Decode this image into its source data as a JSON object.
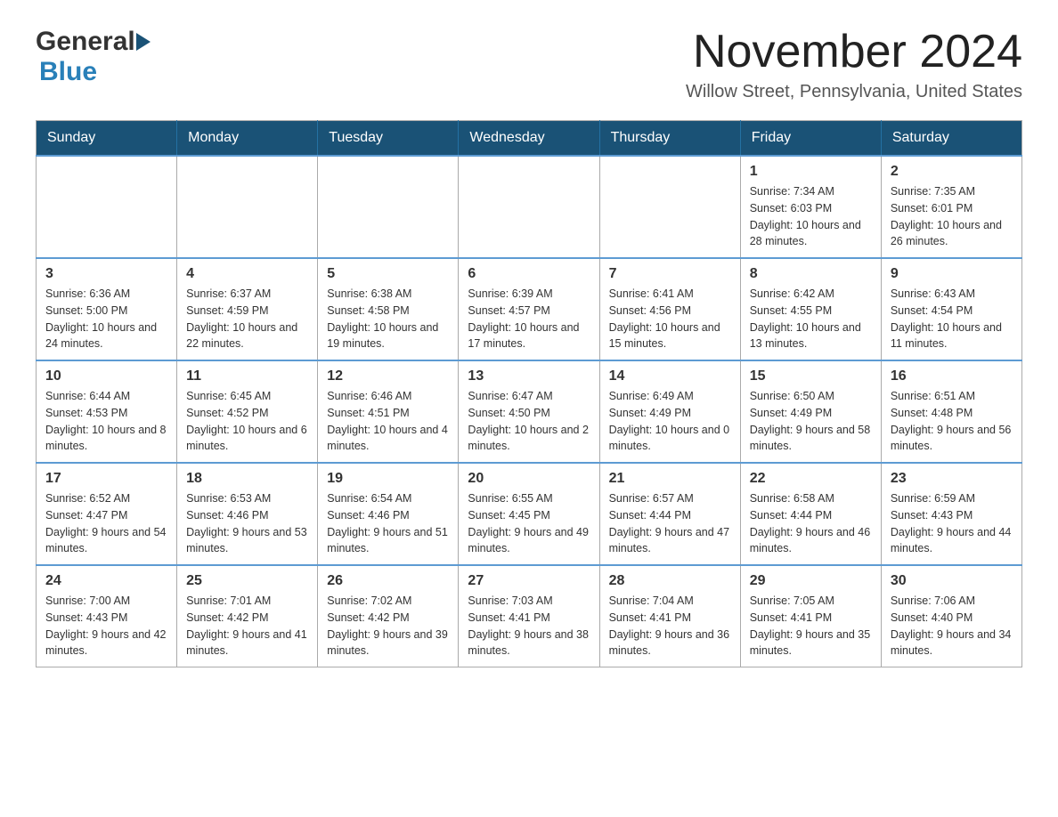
{
  "header": {
    "logo_general": "General",
    "logo_blue": "Blue",
    "month_title": "November 2024",
    "location": "Willow Street, Pennsylvania, United States"
  },
  "calendar": {
    "days_of_week": [
      "Sunday",
      "Monday",
      "Tuesday",
      "Wednesday",
      "Thursday",
      "Friday",
      "Saturday"
    ],
    "weeks": [
      {
        "days": [
          {
            "number": "",
            "info": ""
          },
          {
            "number": "",
            "info": ""
          },
          {
            "number": "",
            "info": ""
          },
          {
            "number": "",
            "info": ""
          },
          {
            "number": "",
            "info": ""
          },
          {
            "number": "1",
            "info": "Sunrise: 7:34 AM\nSunset: 6:03 PM\nDaylight: 10 hours and 28 minutes."
          },
          {
            "number": "2",
            "info": "Sunrise: 7:35 AM\nSunset: 6:01 PM\nDaylight: 10 hours and 26 minutes."
          }
        ]
      },
      {
        "days": [
          {
            "number": "3",
            "info": "Sunrise: 6:36 AM\nSunset: 5:00 PM\nDaylight: 10 hours and 24 minutes."
          },
          {
            "number": "4",
            "info": "Sunrise: 6:37 AM\nSunset: 4:59 PM\nDaylight: 10 hours and 22 minutes."
          },
          {
            "number": "5",
            "info": "Sunrise: 6:38 AM\nSunset: 4:58 PM\nDaylight: 10 hours and 19 minutes."
          },
          {
            "number": "6",
            "info": "Sunrise: 6:39 AM\nSunset: 4:57 PM\nDaylight: 10 hours and 17 minutes."
          },
          {
            "number": "7",
            "info": "Sunrise: 6:41 AM\nSunset: 4:56 PM\nDaylight: 10 hours and 15 minutes."
          },
          {
            "number": "8",
            "info": "Sunrise: 6:42 AM\nSunset: 4:55 PM\nDaylight: 10 hours and 13 minutes."
          },
          {
            "number": "9",
            "info": "Sunrise: 6:43 AM\nSunset: 4:54 PM\nDaylight: 10 hours and 11 minutes."
          }
        ]
      },
      {
        "days": [
          {
            "number": "10",
            "info": "Sunrise: 6:44 AM\nSunset: 4:53 PM\nDaylight: 10 hours and 8 minutes."
          },
          {
            "number": "11",
            "info": "Sunrise: 6:45 AM\nSunset: 4:52 PM\nDaylight: 10 hours and 6 minutes."
          },
          {
            "number": "12",
            "info": "Sunrise: 6:46 AM\nSunset: 4:51 PM\nDaylight: 10 hours and 4 minutes."
          },
          {
            "number": "13",
            "info": "Sunrise: 6:47 AM\nSunset: 4:50 PM\nDaylight: 10 hours and 2 minutes."
          },
          {
            "number": "14",
            "info": "Sunrise: 6:49 AM\nSunset: 4:49 PM\nDaylight: 10 hours and 0 minutes."
          },
          {
            "number": "15",
            "info": "Sunrise: 6:50 AM\nSunset: 4:49 PM\nDaylight: 9 hours and 58 minutes."
          },
          {
            "number": "16",
            "info": "Sunrise: 6:51 AM\nSunset: 4:48 PM\nDaylight: 9 hours and 56 minutes."
          }
        ]
      },
      {
        "days": [
          {
            "number": "17",
            "info": "Sunrise: 6:52 AM\nSunset: 4:47 PM\nDaylight: 9 hours and 54 minutes."
          },
          {
            "number": "18",
            "info": "Sunrise: 6:53 AM\nSunset: 4:46 PM\nDaylight: 9 hours and 53 minutes."
          },
          {
            "number": "19",
            "info": "Sunrise: 6:54 AM\nSunset: 4:46 PM\nDaylight: 9 hours and 51 minutes."
          },
          {
            "number": "20",
            "info": "Sunrise: 6:55 AM\nSunset: 4:45 PM\nDaylight: 9 hours and 49 minutes."
          },
          {
            "number": "21",
            "info": "Sunrise: 6:57 AM\nSunset: 4:44 PM\nDaylight: 9 hours and 47 minutes."
          },
          {
            "number": "22",
            "info": "Sunrise: 6:58 AM\nSunset: 4:44 PM\nDaylight: 9 hours and 46 minutes."
          },
          {
            "number": "23",
            "info": "Sunrise: 6:59 AM\nSunset: 4:43 PM\nDaylight: 9 hours and 44 minutes."
          }
        ]
      },
      {
        "days": [
          {
            "number": "24",
            "info": "Sunrise: 7:00 AM\nSunset: 4:43 PM\nDaylight: 9 hours and 42 minutes."
          },
          {
            "number": "25",
            "info": "Sunrise: 7:01 AM\nSunset: 4:42 PM\nDaylight: 9 hours and 41 minutes."
          },
          {
            "number": "26",
            "info": "Sunrise: 7:02 AM\nSunset: 4:42 PM\nDaylight: 9 hours and 39 minutes."
          },
          {
            "number": "27",
            "info": "Sunrise: 7:03 AM\nSunset: 4:41 PM\nDaylight: 9 hours and 38 minutes."
          },
          {
            "number": "28",
            "info": "Sunrise: 7:04 AM\nSunset: 4:41 PM\nDaylight: 9 hours and 36 minutes."
          },
          {
            "number": "29",
            "info": "Sunrise: 7:05 AM\nSunset: 4:41 PM\nDaylight: 9 hours and 35 minutes."
          },
          {
            "number": "30",
            "info": "Sunrise: 7:06 AM\nSunset: 4:40 PM\nDaylight: 9 hours and 34 minutes."
          }
        ]
      }
    ]
  }
}
